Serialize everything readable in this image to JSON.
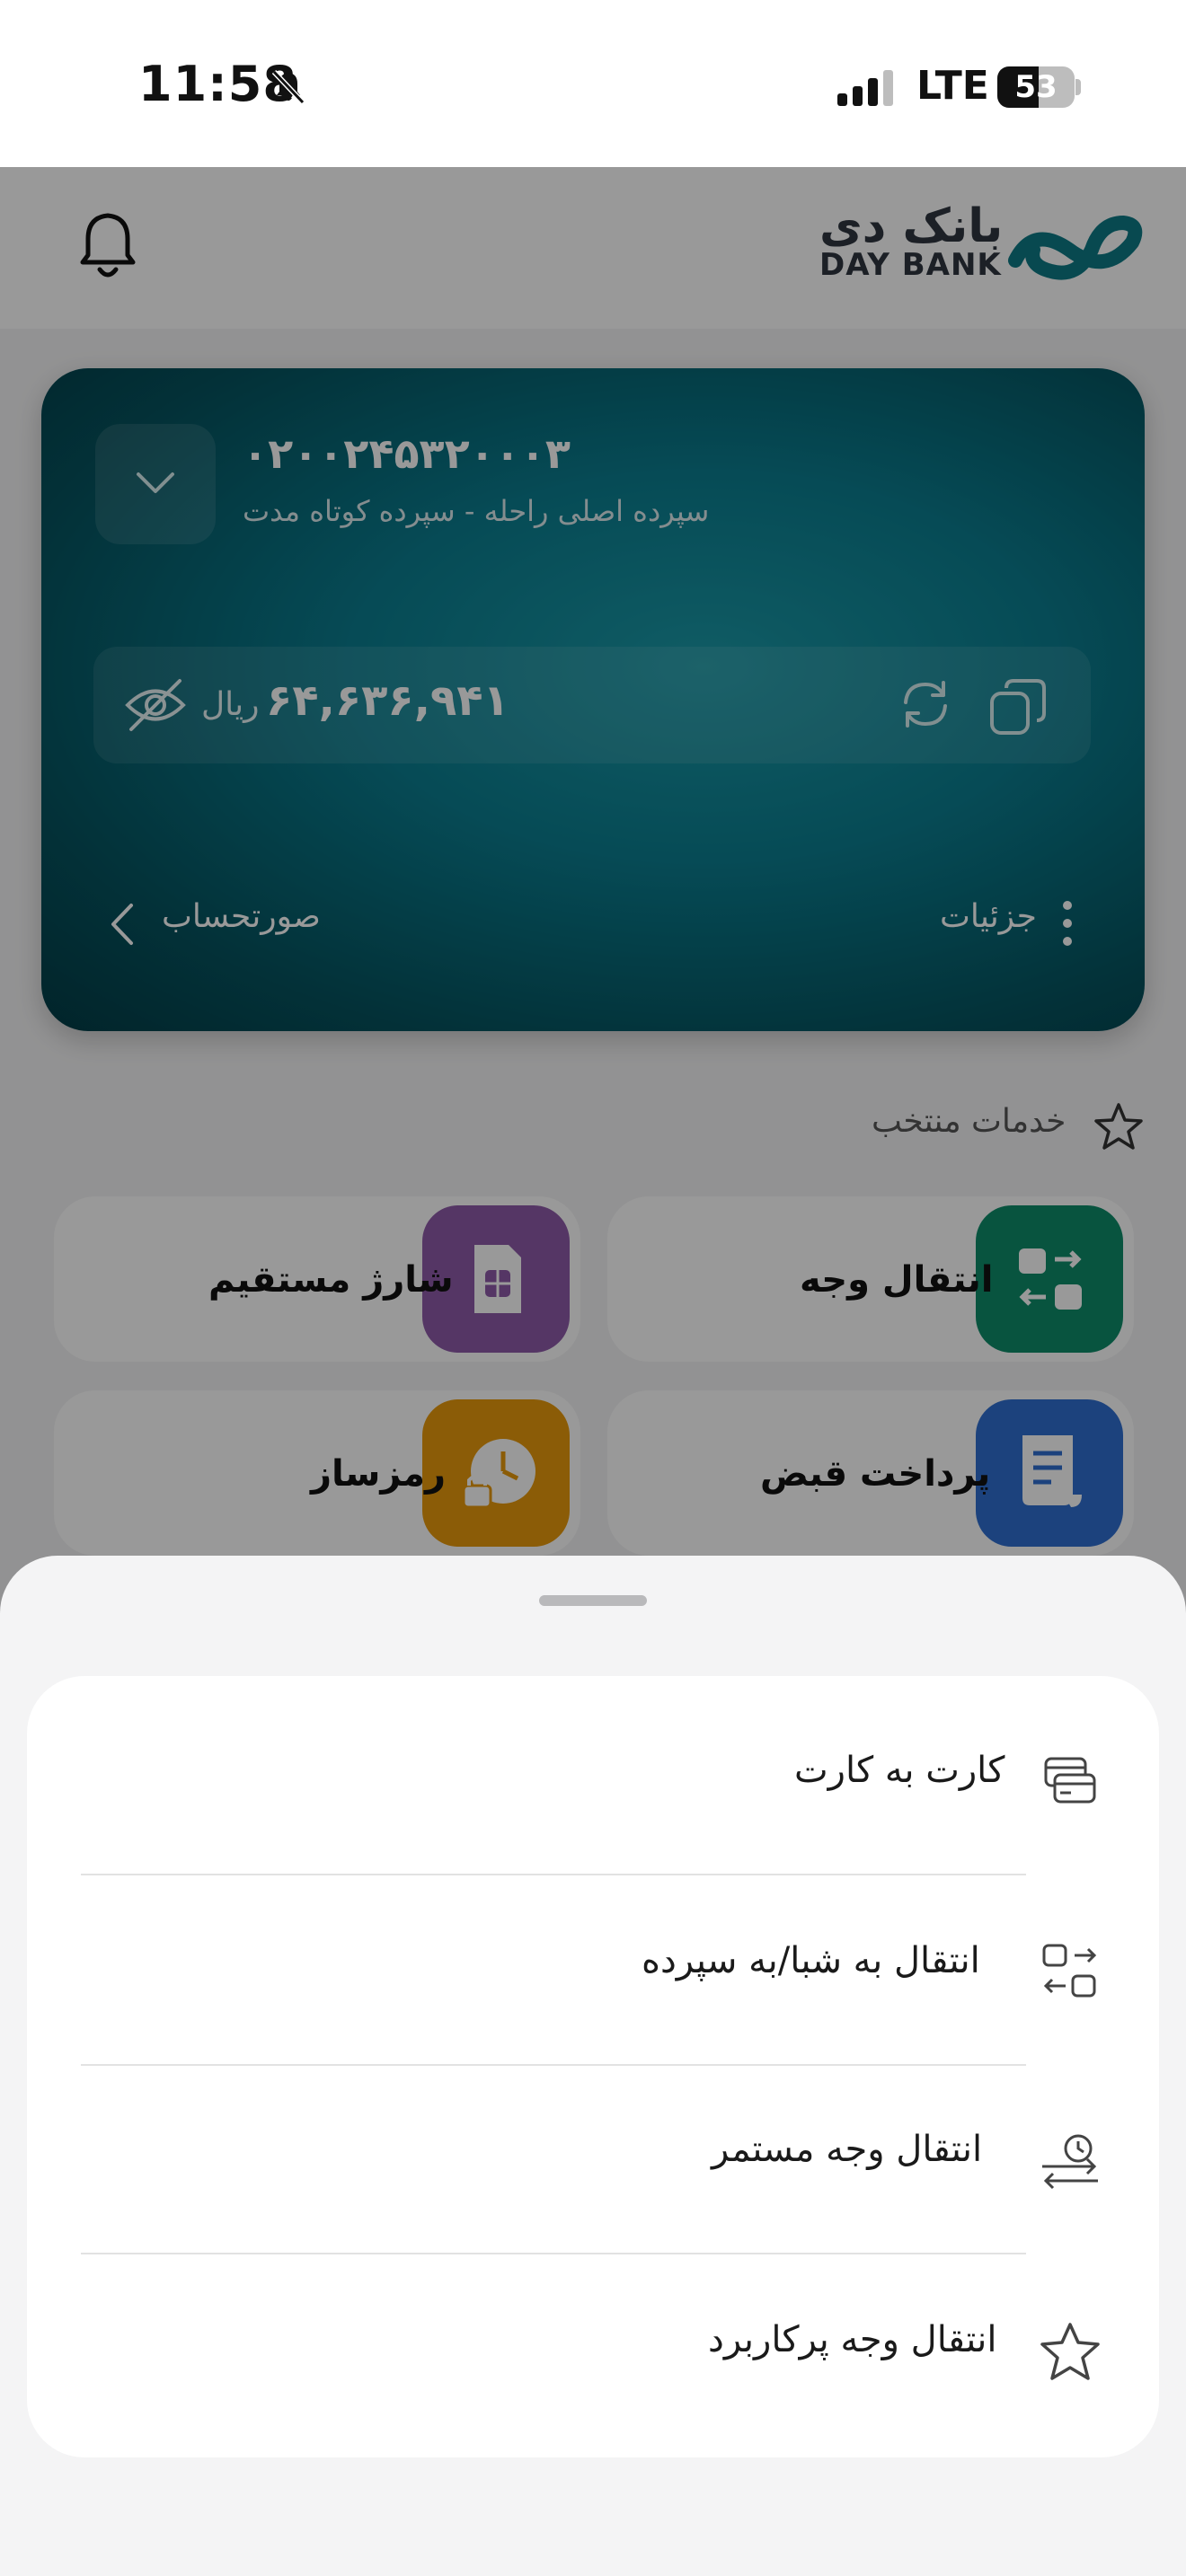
{
  "status_bar": {
    "time": "11:58",
    "network": "LTE",
    "battery": "53"
  },
  "header": {
    "logo_fa": "بانک دی",
    "logo_en": "DAY BANK"
  },
  "account_card": {
    "account_number": "۰۲۰۰۲۴۵۳۲۰۰۰۳",
    "account_subtitle": "سپرده اصلی راحله - سپرده کوتاه مدت",
    "balance": "۶۴,۶۳۶,۹۴۱",
    "currency": "ریال",
    "statement_label": "صورتحساب",
    "details_label": "جزئیات"
  },
  "featured": {
    "title": "خدمات منتخب",
    "tiles": [
      {
        "label": "انتقال وجه",
        "color": "#0e8c6a",
        "icon": "transfer-icon"
      },
      {
        "label": "شارژ مستقیم",
        "color": "#8e5ba8",
        "icon": "sim-card-icon"
      },
      {
        "label": "پرداخت قبض",
        "color": "#2f6fd0",
        "icon": "bill-icon"
      },
      {
        "label": "رمزساز",
        "color": "#e89a0d",
        "icon": "otp-icon"
      }
    ]
  },
  "sheet": {
    "options": [
      {
        "label": "کارت به کارت",
        "icon": "card-to-card-icon"
      },
      {
        "label": "انتقال به شبا/به سپرده",
        "icon": "shaba-transfer-icon"
      },
      {
        "label": "انتقال وجه مستمر",
        "icon": "recurring-transfer-icon"
      },
      {
        "label": "انتقال وجه پرکاربرد",
        "icon": "favorite-transfer-icon"
      }
    ]
  }
}
